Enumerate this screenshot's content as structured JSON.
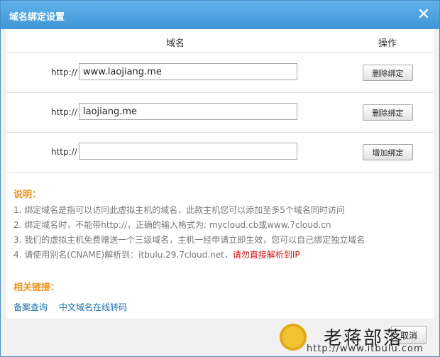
{
  "dialog": {
    "title": "域名绑定设置",
    "close_glyph": "✕"
  },
  "table": {
    "header_domain": "域名",
    "header_operation": "操作",
    "prefix": "http://",
    "rows": [
      {
        "value": "www.laojiang.me",
        "button": "删除绑定"
      },
      {
        "value": "laojiang.me",
        "button": "删除绑定"
      },
      {
        "value": "",
        "button": "增加绑定"
      }
    ]
  },
  "notes": {
    "title": "说明：",
    "items": [
      "1. 绑定域名是指可以访问此虚拟主机的域名，此款主机您可以添加至多5个域名同时访问",
      "2. 绑定域名时，不能带http://，正确的输入格式为: mycloud.cb或www.7cloud.cn",
      "3. 我们的虚拟主机免费赠送一个三级域名，主机一经申请立即生效，您可以自己绑定独立域名"
    ],
    "item4_prefix": "4. 请使用别名(CNAME)解析到：itbulu.29.7cloud.net，",
    "item4_warning": "请勿直接解析到IP"
  },
  "links": {
    "title": "相关链接：",
    "items": [
      "备案查询",
      "中文域名在线转码"
    ]
  },
  "footer": {
    "cancel_label": "取消"
  },
  "watermark": {
    "text": "老蒋部落",
    "url": "http://www.itbulu.com"
  },
  "colors": {
    "titlebar": "#4aa3e2",
    "section_title": "#e8931c",
    "link": "#1a6fa8",
    "warning": "#cc1111"
  }
}
